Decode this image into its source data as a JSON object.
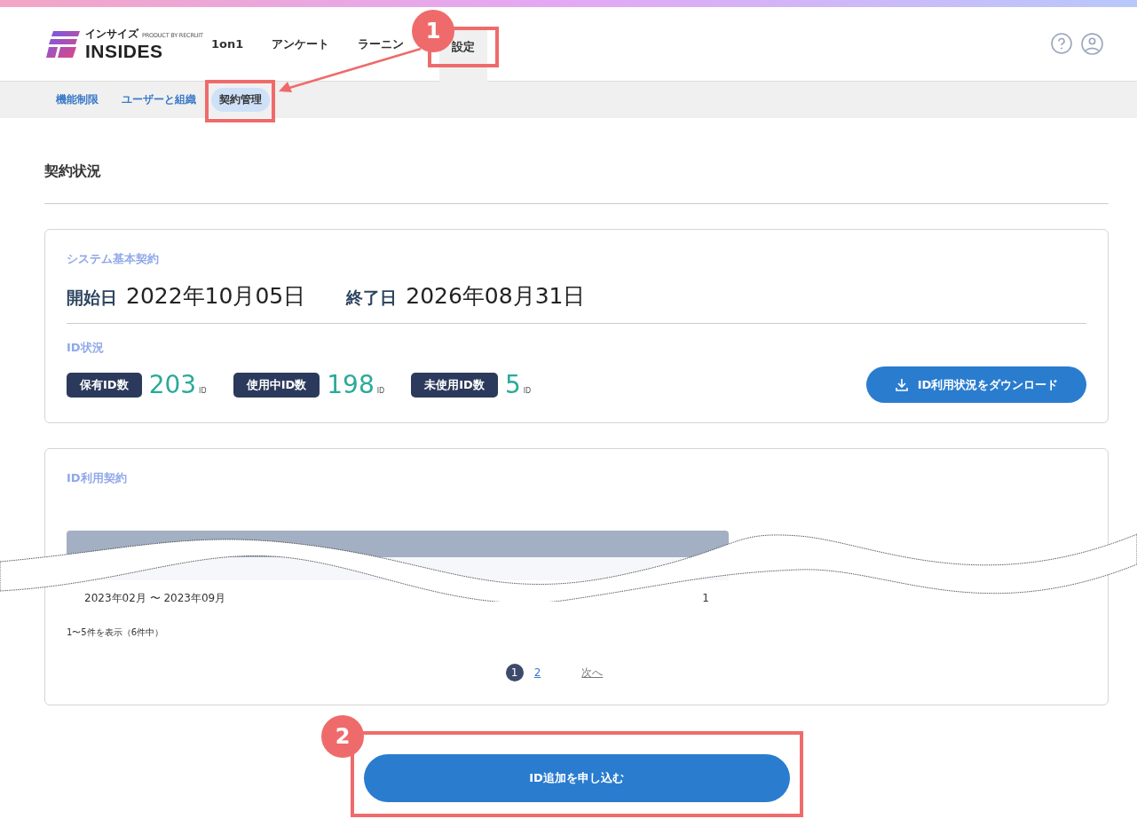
{
  "header": {
    "logo_kana": "インサイズ",
    "logo_by": "PRODUCT BY RECRUIT",
    "logo_name": "INSIDES",
    "nav": [
      {
        "label": "1on1",
        "selected": false
      },
      {
        "label": "アンケート",
        "selected": false
      },
      {
        "label": "ラーニン",
        "selected": false
      },
      {
        "label": "設定",
        "selected": true
      }
    ]
  },
  "subnav": [
    {
      "label": "機能制限",
      "selected": false
    },
    {
      "label": "ユーザーと組織",
      "selected": false
    },
    {
      "label": "契約管理",
      "selected": true
    }
  ],
  "page_title": "契約状況",
  "system_contract": {
    "title": "システム基本契約",
    "start_label": "開始日",
    "start": "2022年10月05日",
    "end_label": "終了日",
    "end": "2026年08月31日",
    "status_title": "ID状況",
    "stats": [
      {
        "label": "保有ID数",
        "value": "203",
        "unit": "ID"
      },
      {
        "label": "使用中ID数",
        "value": "198",
        "unit": "ID"
      },
      {
        "label": "未使用ID数",
        "value": "5",
        "unit": "ID"
      }
    ],
    "download_button": "ID利用状況をダウンロード"
  },
  "id_contract": {
    "title": "ID利用契約",
    "rows": [
      {
        "period": "2023年02月 〜 2023年09月",
        "count": "1"
      }
    ],
    "summary": "1〜5件を表示（6件中）",
    "pages": [
      {
        "label": "1",
        "selected": true
      },
      {
        "label": "2",
        "selected": false
      }
    ],
    "next": "次へ"
  },
  "apply_button": "ID追加を申し込む",
  "annotations": [
    {
      "number": "1"
    },
    {
      "number": "2"
    }
  ]
}
